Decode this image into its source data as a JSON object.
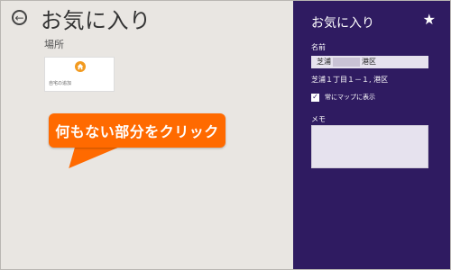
{
  "header": {
    "title": "お気に入り"
  },
  "places": {
    "section_label": "場所",
    "tile_label": "自宅の追加",
    "tile_icon": "home-icon"
  },
  "callout": {
    "text": "何もない部分をクリック",
    "color": "#ff6a00"
  },
  "pane": {
    "title": "お気に入り",
    "pin_icon": "★",
    "name_label": "名前",
    "name_prefix": "芝浦",
    "name_suffix": "港区",
    "address": "芝浦１丁目１－１, 港区",
    "checkbox_label": "常にマップに表示",
    "checkbox_checked": true,
    "memo_label": "メモ",
    "background": "#2f1b61"
  },
  "back_icon": "←"
}
